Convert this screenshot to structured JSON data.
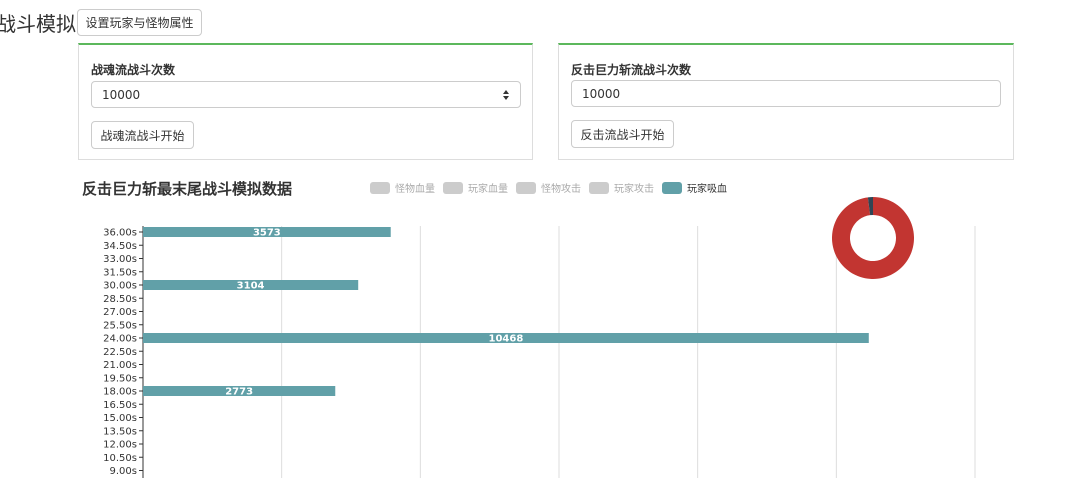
{
  "page": {
    "title": "战斗模拟"
  },
  "header": {
    "settings_button": "设置玩家与怪物属性"
  },
  "panel_left": {
    "label": "战魂流战斗次数",
    "input_value": "10000",
    "start_button": "战魂流战斗开始"
  },
  "panel_right": {
    "label": "反击巨力斩流战斗次数",
    "input_value": "10000",
    "start_button": "反击流战斗开始"
  },
  "colors": {
    "accent_green": "#5cb85c",
    "bar": "#61a0a8",
    "pie_main": "#c23531",
    "pie_minor": "#2f4554",
    "legend_inactive": "#cccccc"
  },
  "chart_data": {
    "type": "bar",
    "orientation": "horizontal",
    "title": "反击巨力斩最末尾战斗模拟数据",
    "legend": [
      {
        "name": "怪物血量",
        "active": false
      },
      {
        "name": "玩家血量",
        "active": false
      },
      {
        "name": "怪物攻击",
        "active": false
      },
      {
        "name": "玩家攻击",
        "active": false
      },
      {
        "name": "玩家吸血",
        "active": true
      }
    ],
    "categories": [
      "36.00s",
      "34.50s",
      "33.00s",
      "31.50s",
      "30.00s",
      "28.50s",
      "27.00s",
      "25.50s",
      "24.00s",
      "22.50s",
      "21.00s",
      "19.50s",
      "18.00s",
      "16.50s",
      "15.00s",
      "13.50s",
      "12.00s",
      "10.50s",
      "9.00s"
    ],
    "series": [
      {
        "name": "玩家吸血",
        "values": [
          3573,
          null,
          null,
          null,
          3104,
          null,
          null,
          null,
          10468,
          null,
          null,
          null,
          2773,
          null,
          null,
          null,
          null,
          null,
          null
        ]
      }
    ],
    "xlim": [
      0,
      12000
    ],
    "grid": true,
    "pie": {
      "values": [
        98,
        2
      ]
    }
  }
}
